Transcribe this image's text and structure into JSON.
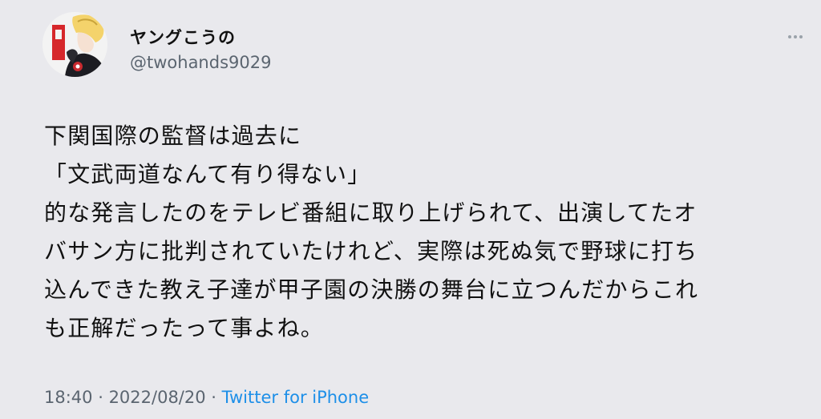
{
  "author": {
    "display_name": "ヤングこうの",
    "handle": "@twohands9029"
  },
  "icons": {
    "avatar": "anime-avatar",
    "more": "more-options-icon"
  },
  "tweet": {
    "lines": [
      "下関国際の監督は過去に",
      "「文武両道なんて有り得ない」",
      "的な発言したのをテレビ番組に取り上げられて、出演してたオ",
      "バサン方に批判されていたけれど、実際は死ぬ気で野球に打ち",
      "込んできた教え子達が甲子園の決勝の舞台に立つんだからこれ",
      "も正解だったって事よね。"
    ]
  },
  "meta": {
    "time": "18:40",
    "separator1": " · ",
    "date": "2022/08/20",
    "separator2": " · ",
    "source": "Twitter for iPhone"
  },
  "colors": {
    "background": "#e9e9ed",
    "text": "#111111",
    "muted": "#5b6570",
    "link": "#1d8fe8"
  }
}
